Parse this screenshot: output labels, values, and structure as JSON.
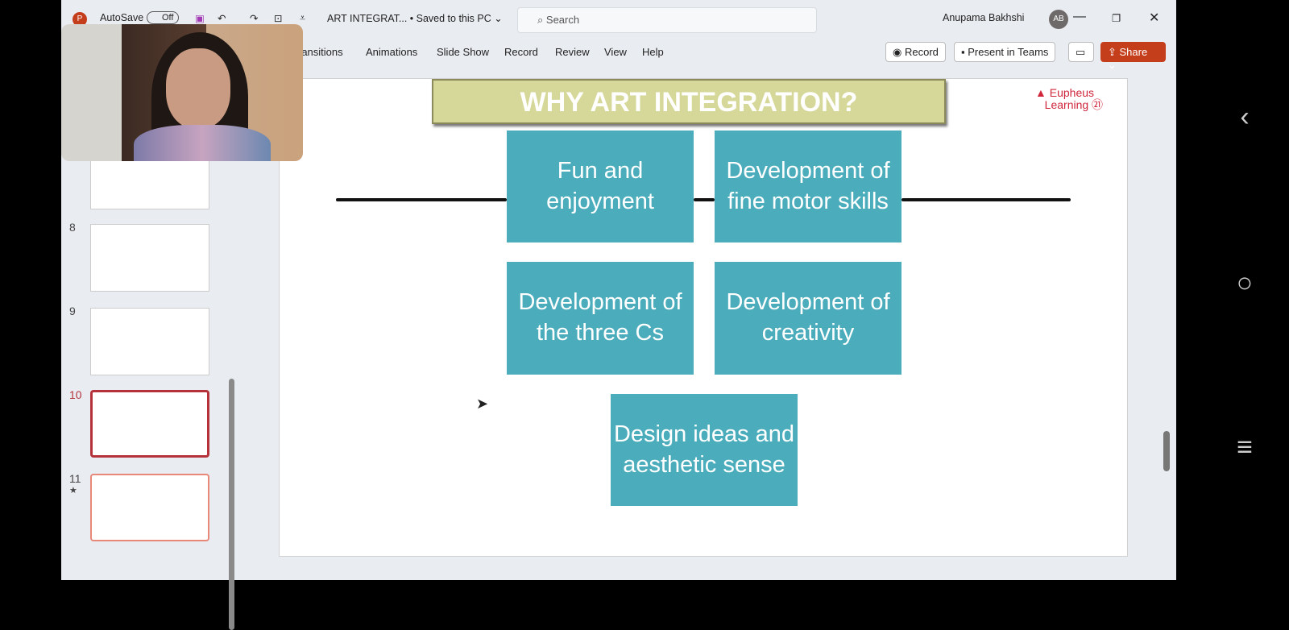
{
  "titlebar": {
    "autosave_label": "AutoSave",
    "autosave_state": "Off",
    "doc_title": "ART INTEGRAT...  •  Saved to this PC",
    "search_placeholder": "Search",
    "user_name": "Anupama Bakhshi",
    "user_initials": "AB"
  },
  "ribbon": {
    "tabs": [
      "ransitions",
      "Animations",
      "Slide Show",
      "Record",
      "Review",
      "View",
      "Help"
    ],
    "record_button": "Record",
    "present_button": "Present in Teams",
    "share_button": "Share"
  },
  "thumbnails": [
    {
      "num": "8"
    },
    {
      "num": "9"
    },
    {
      "num": "10",
      "selected": true
    },
    {
      "num": "11",
      "star": "★"
    }
  ],
  "slide": {
    "title": "WHY ART INTEGRATION?",
    "logo_text": "Eupheus Learning",
    "boxes": [
      "Fun and enjoyment",
      "Development of fine motor skills",
      "Development of the three Cs",
      "Development of creativity",
      "Design ideas and aesthetic sense"
    ],
    "box_color": "#4badbc",
    "title_color": "#d6d89a"
  },
  "colors": {
    "accent": "#c43e1c"
  }
}
